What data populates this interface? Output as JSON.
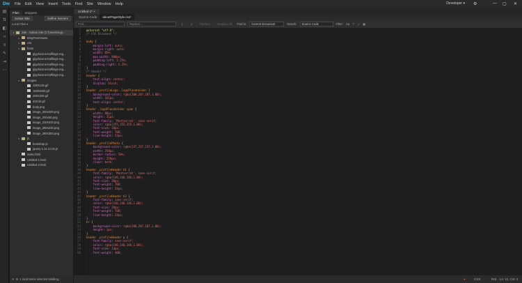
{
  "app": {
    "logo": "Dw",
    "menus": [
      "File",
      "Edit",
      "View",
      "Insert",
      "Tools",
      "Find",
      "Site",
      "Window",
      "Help"
    ],
    "workspace": "Developer ▾"
  },
  "panel": {
    "tabs": [
      "Files",
      "Snippets"
    ],
    "site_select": "Suhas Site",
    "define_btn": "Define Servers",
    "local_files": "Local Files ▾",
    "tree": [
      {
        "label": "Site - Suhas Site (C:\\Users\\sugi...",
        "depth": 0,
        "type": "root",
        "sel": true
      },
      {
        "label": "BlogPostAssets",
        "depth": 1,
        "type": "folder"
      },
      {
        "label": "css",
        "depth": 1,
        "type": "folder"
      },
      {
        "label": "fonts",
        "depth": 1,
        "type": "folder"
      },
      {
        "label": "glyphicons-halflings-reg...",
        "depth": 2,
        "type": "file"
      },
      {
        "label": "glyphicons-halflings-reg...",
        "depth": 2,
        "type": "file"
      },
      {
        "label": "glyphicons-halflings-reg...",
        "depth": 2,
        "type": "file"
      },
      {
        "label": "glyphicons-halflings-reg...",
        "depth": 2,
        "type": "file"
      },
      {
        "label": "glyphicons-halflings-reg...",
        "depth": 2,
        "type": "file"
      },
      {
        "label": "images",
        "depth": 1,
        "type": "folder"
      },
      {
        "label": "100X125.gif",
        "depth": 2,
        "type": "file"
      },
      {
        "label": "1630x500.gif",
        "depth": 2,
        "type": "file"
      },
      {
        "label": "400X200.gif",
        "depth": 2,
        "type": "file"
      },
      {
        "label": "40X40.gif",
        "depth": 2,
        "type": "file"
      },
      {
        "label": "body.png",
        "depth": 2,
        "type": "file"
      },
      {
        "label": "image_200x200.png",
        "depth": 2,
        "type": "file"
      },
      {
        "label": "image_200x50.png",
        "depth": 2,
        "type": "file"
      },
      {
        "label": "image_310x310.png",
        "depth": 2,
        "type": "file"
      },
      {
        "label": "image_380x230.png",
        "depth": 2,
        "type": "file"
      },
      {
        "label": "image_380x350.png",
        "depth": 2,
        "type": "file"
      },
      {
        "label": "js",
        "depth": 1,
        "type": "folder"
      },
      {
        "label": "bootstrap.js",
        "depth": 2,
        "type": "file"
      },
      {
        "label": "jquery-1.11.3.min.js",
        "depth": 2,
        "type": "file"
      },
      {
        "label": "index.html",
        "depth": 1,
        "type": "file"
      },
      {
        "label": "Untitled-1.html",
        "depth": 1,
        "type": "file"
      },
      {
        "label": "Untitled-2.html",
        "depth": 1,
        "type": "file"
      }
    ],
    "status": "1 local items selected totalling..."
  },
  "doc": {
    "tab": "Untitled-2* ×",
    "src_tabs": [
      "Source Code",
      "aboutPageStyle.css*"
    ],
    "find": {
      "find_placeholder": "Find...",
      "replace_placeholder": "Replace...",
      "replace_btn": "Replace",
      "replace_all_btn": "Replace All",
      "find_in_label": "Find in:",
      "find_in": "Current Document",
      "search_label": "Search:",
      "search": "Source Code",
      "filter_label": "Filter:"
    },
    "lines": [
      "@charset \"utf-8\";",
      "/* CSS Document */",
      "",
      "body {",
      "    margin-left: auto;",
      "    margin-right: auto;",
      "    width: 85%;",
      "    max-width: 900px;",
      "    padding-left: 2.25%;",
      "    padding-right: 2.25%;",
      "}",
      "/* Header */",
      "header {",
      "    text-align: center;",
      "    display: block;",
      "}",
      "header .profileLogo .logoPlaceholder {",
      "    background-color: rgba(200,207,207,1.00);",
      "    width: 161px;",
      "    text-align: center;",
      "}",
      "header .logoPlaceholder span {",
      "    width: 80px;",
      "    height: 31px;",
      "    font-family: 'Montserrat', sans-serif;",
      "    color: rgba(255,255,255,1.00);",
      "    font-size: 10px;",
      "    font-weight: 700;",
      "    line-height: 53px;",
      "}",
      "header .profilePhoto {",
      "    background-color: rgba(237,237,237,1.00);",
      "    width: 259px;",
      "    border-radius: 50%;",
      "    height: 259px;",
      "    clear: both;",
      "}",
      "header .profileHeader h1 {",
      "    font-family: 'Montserrat', sans-serif;",
      "    color: rgba(146,146,146,1.00);",
      "    font-size: 38px;",
      "    font-weight: 700;",
      "    line-height: 24px;",
      "}",
      "header .profileHeader h3 {",
      "    font-family: sans-serif;",
      "    color: rgba(146,146,146,1.00);",
      "    font-size: 19px;",
      "    font-weight: 700;",
      "    line-height: 24px;",
      "}",
      "hr {",
      "    background-color: rgba(208,207,207,1.00);",
      "    height: 1px;",
      "}",
      "header .profileHeader p {",
      "    font-family: sans-serif;",
      "    color: rgba(146,146,146,1.00);",
      "    font-size: 14px;",
      "    font-weight: 400;"
    ],
    "status": {
      "lang": "CSS",
      "mode": "INS",
      "pos": "Ln: 11, Col: 2"
    }
  }
}
